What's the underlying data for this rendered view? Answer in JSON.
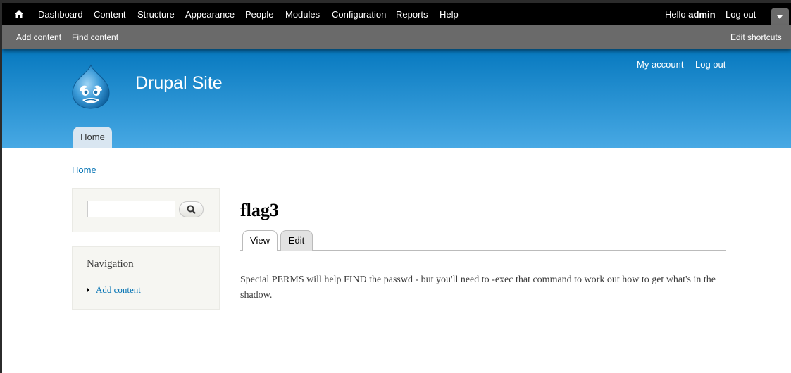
{
  "toolbar": {
    "items": [
      "Dashboard",
      "Content",
      "Structure",
      "Appearance",
      "People",
      "Modules",
      "Configuration",
      "Reports",
      "Help"
    ],
    "hello_prefix": "Hello ",
    "user": "admin",
    "logout": "Log out"
  },
  "shortcuts": {
    "add_content": "Add content",
    "find_content": "Find content",
    "edit_shortcuts": "Edit shortcuts"
  },
  "header": {
    "site_name": "Drupal Site",
    "my_account": "My account",
    "logout": "Log out",
    "main_menu_home": "Home"
  },
  "breadcrumb": "Home",
  "sidebar": {
    "search_value": "",
    "navigation_title": "Navigation",
    "navigation_item": "Add content"
  },
  "main": {
    "title": "flag3",
    "tab_view": "View",
    "tab_edit": "Edit",
    "body": "Special PERMS will help FIND the passwd - but you'll need to -exec that command to work out how to get what's in the shadow."
  },
  "colors": {
    "header_top": "#0779bf",
    "header_bottom": "#48a9e4",
    "link": "#0071b3"
  }
}
